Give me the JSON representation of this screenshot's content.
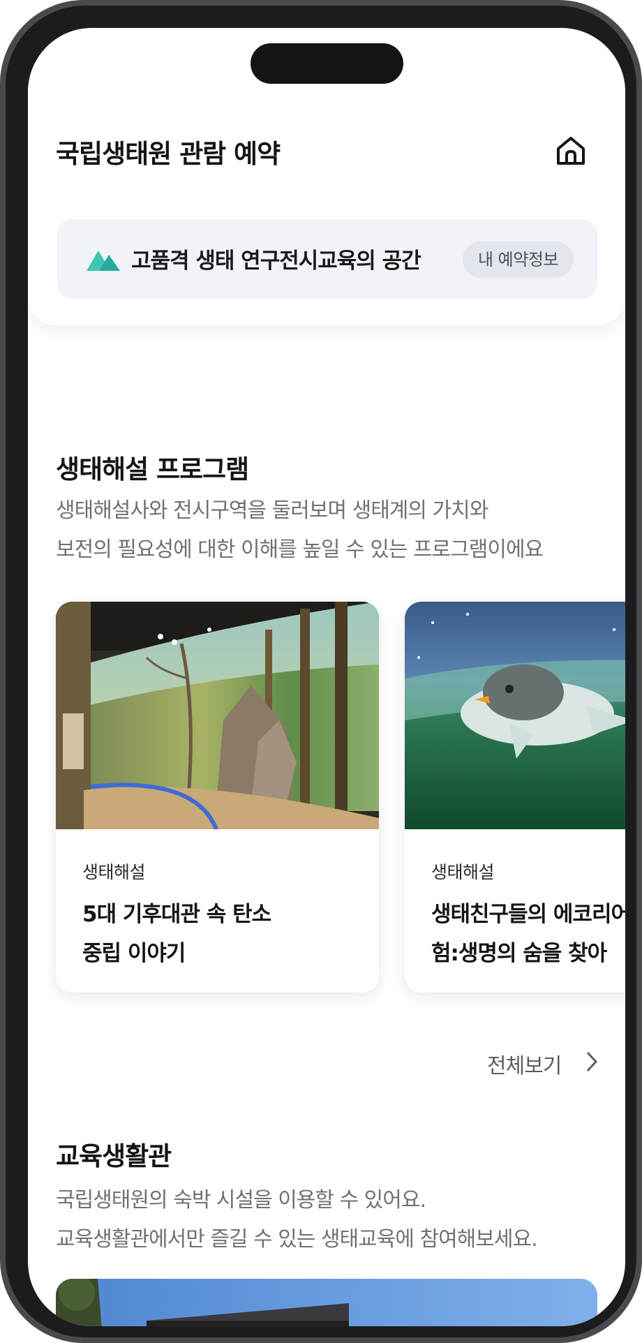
{
  "header": {
    "title": "국립생태원 관람 예약",
    "home_icon": "home-icon"
  },
  "banner": {
    "icon": "mountain-icon",
    "text": "고품격 생태 연구전시교육의 공간",
    "my_reservation_label": "내 예약정보"
  },
  "eco_program": {
    "title": "생태해설 프로그램",
    "description_line1": "생태해설사와 전시구역을 둘러보며 생태계의 가치와",
    "description_line2": "보전의 필요성에 대한 이해를 높일 수 있는 프로그램이에요",
    "cards": [
      {
        "tag": "생태해설",
        "title": "5대 기후대관 속 탄소\n중립 이야기"
      },
      {
        "tag": "생태해설",
        "title": "생태친구들의 에코리어\n험:생명의 숨을 찾아"
      }
    ],
    "see_all_label": "전체보기"
  },
  "education_hall": {
    "title": "교육생활관",
    "description_line1": "국립생태원의 숙박 시설을 이용할 수 있어요.",
    "description_line2": "교육생활관에서만 즐길 수 있는 생태교육에 참여해보세요."
  },
  "colors": {
    "accent_teal": "#2fb8a8",
    "banner_bg": "#f0f3f8",
    "text_dark": "#151515",
    "text_muted": "#6e7176"
  }
}
